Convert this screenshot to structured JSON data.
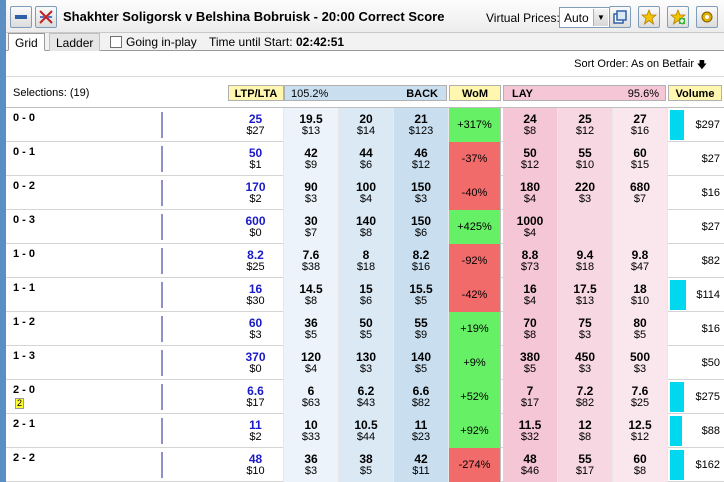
{
  "window": {
    "title": "Shakhter Soligorsk v Belshina Bobruisk - 20:00 Correct Score",
    "virtual_prices_label": "Virtual Prices:",
    "virtual_prices_value": "Auto"
  },
  "tabs": [
    {
      "label": "Grid",
      "active": true
    },
    {
      "label": "Ladder",
      "active": false
    }
  ],
  "going_inplay_label": "Going in-play",
  "time_until_start_label": "Time until Start:",
  "time_until_start_value": "02:42:51",
  "sort_order": "Sort Order: As on Betfair",
  "header": {
    "selections": "Selections: (19)",
    "ltp_lta": "LTP/LTA",
    "back_pct": "105.2%",
    "back": "BACK",
    "wom": "WoM",
    "lay": "LAY",
    "lay_pct": "95.6%",
    "volume": "Volume"
  },
  "colors": {
    "back_header": "#c9dff0",
    "lay_header": "#f5c6d6",
    "wom_header": "#fff7b0",
    "back3": "#c9dff0",
    "back2": "#dbe9f5",
    "back1": "#ecf3fa",
    "lay1": "#f4c6d6",
    "lay2": "#f7d8e2",
    "lay3": "#fae7ee",
    "wom_pos": "#66f066",
    "wom_neg": "#f26b6b",
    "vol_bar": "#00d8f0"
  },
  "rows": [
    {
      "sel": "0 - 0",
      "badge": "",
      "ltp": "25",
      "lta": "$27",
      "back": [
        [
          "19.5",
          "$13"
        ],
        [
          "20",
          "$14"
        ],
        [
          "21",
          "$123"
        ]
      ],
      "wom": "+317%",
      "wom_pos": true,
      "lay": [
        [
          "24",
          "$8"
        ],
        [
          "25",
          "$12"
        ],
        [
          "27",
          "$16"
        ]
      ],
      "volume": "$297",
      "volbar": 0.35
    },
    {
      "sel": "0 - 1",
      "badge": "",
      "ltp": "50",
      "lta": "$1",
      "back": [
        [
          "42",
          "$9"
        ],
        [
          "44",
          "$6"
        ],
        [
          "46",
          "$12"
        ]
      ],
      "wom": "-37%",
      "wom_pos": false,
      "lay": [
        [
          "50",
          "$12"
        ],
        [
          "55",
          "$10"
        ],
        [
          "60",
          "$15"
        ]
      ],
      "volume": "$27",
      "volbar": 0
    },
    {
      "sel": "0 - 2",
      "badge": "",
      "ltp": "170",
      "lta": "$2",
      "back": [
        [
          "90",
          "$3"
        ],
        [
          "100",
          "$4"
        ],
        [
          "150",
          "$3"
        ]
      ],
      "wom": "-40%",
      "wom_pos": false,
      "lay": [
        [
          "180",
          "$4"
        ],
        [
          "220",
          "$3"
        ],
        [
          "680",
          "$7"
        ]
      ],
      "volume": "$16",
      "volbar": 0
    },
    {
      "sel": "0 - 3",
      "badge": "",
      "ltp": "600",
      "lta": "$0",
      "back": [
        [
          "30",
          "$7"
        ],
        [
          "140",
          "$8"
        ],
        [
          "150",
          "$6"
        ]
      ],
      "wom": "+425%",
      "wom_pos": true,
      "lay": [
        [
          "1000",
          "$4"
        ],
        [
          "",
          ""
        ],
        [
          "",
          ""
        ]
      ],
      "volume": "$27",
      "volbar": 0
    },
    {
      "sel": "1 - 0",
      "badge": "",
      "ltp": "8.2",
      "lta": "$25",
      "back": [
        [
          "7.6",
          "$38"
        ],
        [
          "8",
          "$18"
        ],
        [
          "8.2",
          "$16"
        ]
      ],
      "wom": "-92%",
      "wom_pos": false,
      "lay": [
        [
          "8.8",
          "$73"
        ],
        [
          "9.4",
          "$18"
        ],
        [
          "9.8",
          "$47"
        ]
      ],
      "volume": "$82",
      "volbar": 0
    },
    {
      "sel": "1 - 1",
      "badge": "",
      "ltp": "16",
      "lta": "$30",
      "back": [
        [
          "14.5",
          "$8"
        ],
        [
          "15",
          "$6"
        ],
        [
          "15.5",
          "$5"
        ]
      ],
      "wom": "-42%",
      "wom_pos": false,
      "lay": [
        [
          "16",
          "$4"
        ],
        [
          "17.5",
          "$13"
        ],
        [
          "18",
          "$10"
        ]
      ],
      "volume": "$114",
      "volbar": 0.4
    },
    {
      "sel": "1 - 2",
      "badge": "",
      "ltp": "60",
      "lta": "$3",
      "back": [
        [
          "36",
          "$5"
        ],
        [
          "50",
          "$5"
        ],
        [
          "55",
          "$9"
        ]
      ],
      "wom": "+19%",
      "wom_pos": true,
      "lay": [
        [
          "70",
          "$8"
        ],
        [
          "75",
          "$3"
        ],
        [
          "80",
          "$5"
        ]
      ],
      "volume": "$16",
      "volbar": 0
    },
    {
      "sel": "1 - 3",
      "badge": "",
      "ltp": "370",
      "lta": "$0",
      "back": [
        [
          "120",
          "$4"
        ],
        [
          "130",
          "$3"
        ],
        [
          "140",
          "$5"
        ]
      ],
      "wom": "+9%",
      "wom_pos": true,
      "lay": [
        [
          "380",
          "$5"
        ],
        [
          "450",
          "$3"
        ],
        [
          "500",
          "$3"
        ]
      ],
      "volume": "$50",
      "volbar": 0
    },
    {
      "sel": "2 - 0",
      "badge": "2",
      "ltp": "6.6",
      "lta": "$17",
      "back": [
        [
          "6",
          "$63"
        ],
        [
          "6.2",
          "$43"
        ],
        [
          "6.6",
          "$82"
        ]
      ],
      "wom": "+52%",
      "wom_pos": true,
      "lay": [
        [
          "7",
          "$17"
        ],
        [
          "7.2",
          "$82"
        ],
        [
          "7.6",
          "$25"
        ]
      ],
      "volume": "$275",
      "volbar": 0.35
    },
    {
      "sel": "2 - 1",
      "badge": "",
      "ltp": "11",
      "lta": "$2",
      "back": [
        [
          "10",
          "$33"
        ],
        [
          "10.5",
          "$44"
        ],
        [
          "11",
          "$23"
        ]
      ],
      "wom": "+92%",
      "wom_pos": true,
      "lay": [
        [
          "11.5",
          "$32"
        ],
        [
          "12",
          "$8"
        ],
        [
          "12.5",
          "$12"
        ]
      ],
      "volume": "$88",
      "volbar": 0.3
    },
    {
      "sel": "2 - 2",
      "badge": "",
      "ltp": "48",
      "lta": "$10",
      "back": [
        [
          "36",
          "$3"
        ],
        [
          "38",
          "$5"
        ],
        [
          "42",
          "$11"
        ]
      ],
      "wom": "-274%",
      "wom_pos": false,
      "lay": [
        [
          "48",
          "$46"
        ],
        [
          "55",
          "$17"
        ],
        [
          "60",
          "$8"
        ]
      ],
      "volume": "$162",
      "volbar": 0.35
    }
  ]
}
